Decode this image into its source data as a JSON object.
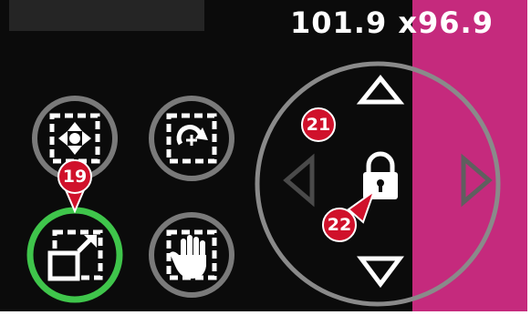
{
  "dimensions": {
    "text": "101.9 x96.9"
  },
  "buttons": {
    "move": {
      "icon": "move-arrows-icon"
    },
    "rotate": {
      "icon": "rotate-icon"
    },
    "resize": {
      "icon": "resize-icon",
      "active": true,
      "active_color": "#3fc54b"
    },
    "pan": {
      "icon": "hand-icon"
    }
  },
  "dpad": {
    "up": "arrow-up-icon",
    "down": "arrow-down-icon",
    "left": "arrow-left-icon",
    "right": "arrow-right-icon",
    "center": "lock-icon"
  },
  "callouts": [
    {
      "label": "19",
      "color": "#d0112b"
    },
    {
      "label": "21",
      "color": "#d0112b"
    },
    {
      "label": "22",
      "color": "#d0112b"
    }
  ],
  "colors": {
    "background": "#0b0b0b",
    "accent_magenta": "#c52a7d",
    "ring_gray": "#7a7a7a",
    "active_green": "#3fc54b"
  }
}
